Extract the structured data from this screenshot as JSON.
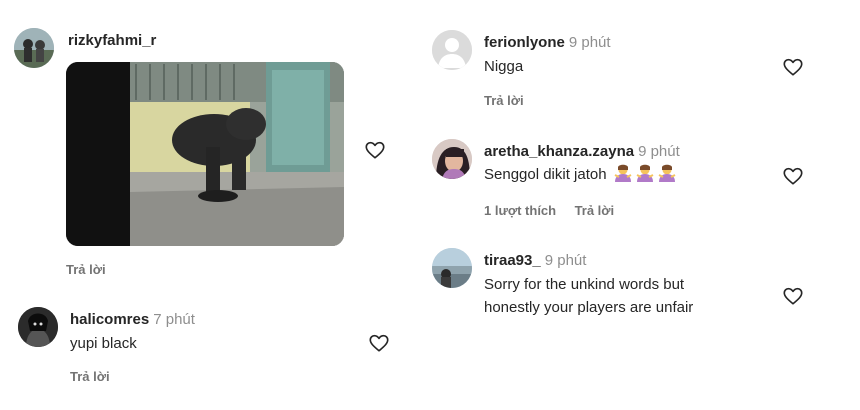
{
  "left": {
    "comments": [
      {
        "username": "rizkyfahmi_r",
        "time": "",
        "text": "",
        "media": "gorilla-gif",
        "reply_label": "Trả lời"
      },
      {
        "username": "halicomres",
        "time": "7 phút",
        "text": "yupi black",
        "reply_label": "Trả lời"
      }
    ]
  },
  "right": {
    "comments": [
      {
        "username": "ferionlyone",
        "time": "9 phút",
        "text": "Nigga",
        "reply_label": "Trả lời"
      },
      {
        "username": "aretha_khanza.zayna",
        "time": "9 phút",
        "text": "Senggol dikit jatoh",
        "emojis": [
          "person-shrugging-emoji",
          "person-shrugging-emoji",
          "person-shrugging-emoji"
        ],
        "likes_label": "1 lượt thích",
        "reply_label": "Trả lời"
      },
      {
        "username": "tiraa93_",
        "time": "9 phút",
        "text_line1": "Sorry for the unkind words but",
        "text_line2": "honestly your players are unfair"
      }
    ]
  },
  "colors": {
    "text": "#262626",
    "secondary": "#737373",
    "time": "#8e8e8e",
    "heart_stroke": "#262626"
  }
}
